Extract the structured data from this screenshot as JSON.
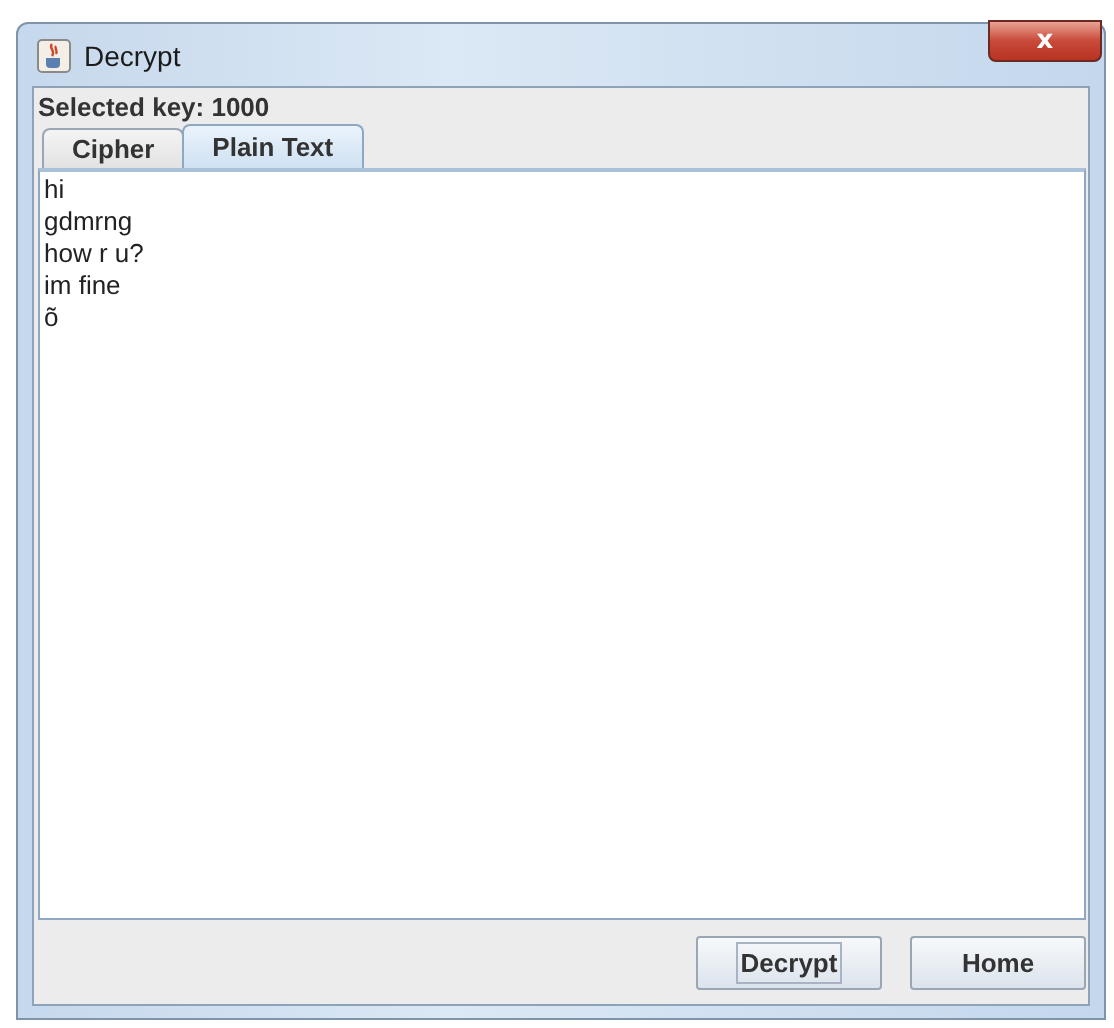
{
  "window": {
    "title": "Decrypt",
    "close": "x"
  },
  "selected_key_label": "Selected key: 1000",
  "tabs": [
    {
      "label": "Cipher",
      "selected": false
    },
    {
      "label": "Plain Text",
      "selected": true
    }
  ],
  "text_area": {
    "lines": [
      "hi",
      "gdmrng",
      "how r u?",
      "im fine",
      "õ"
    ]
  },
  "buttons": [
    {
      "label": "Decrypt",
      "focused": true
    },
    {
      "label": "Home",
      "focused": false
    }
  ]
}
